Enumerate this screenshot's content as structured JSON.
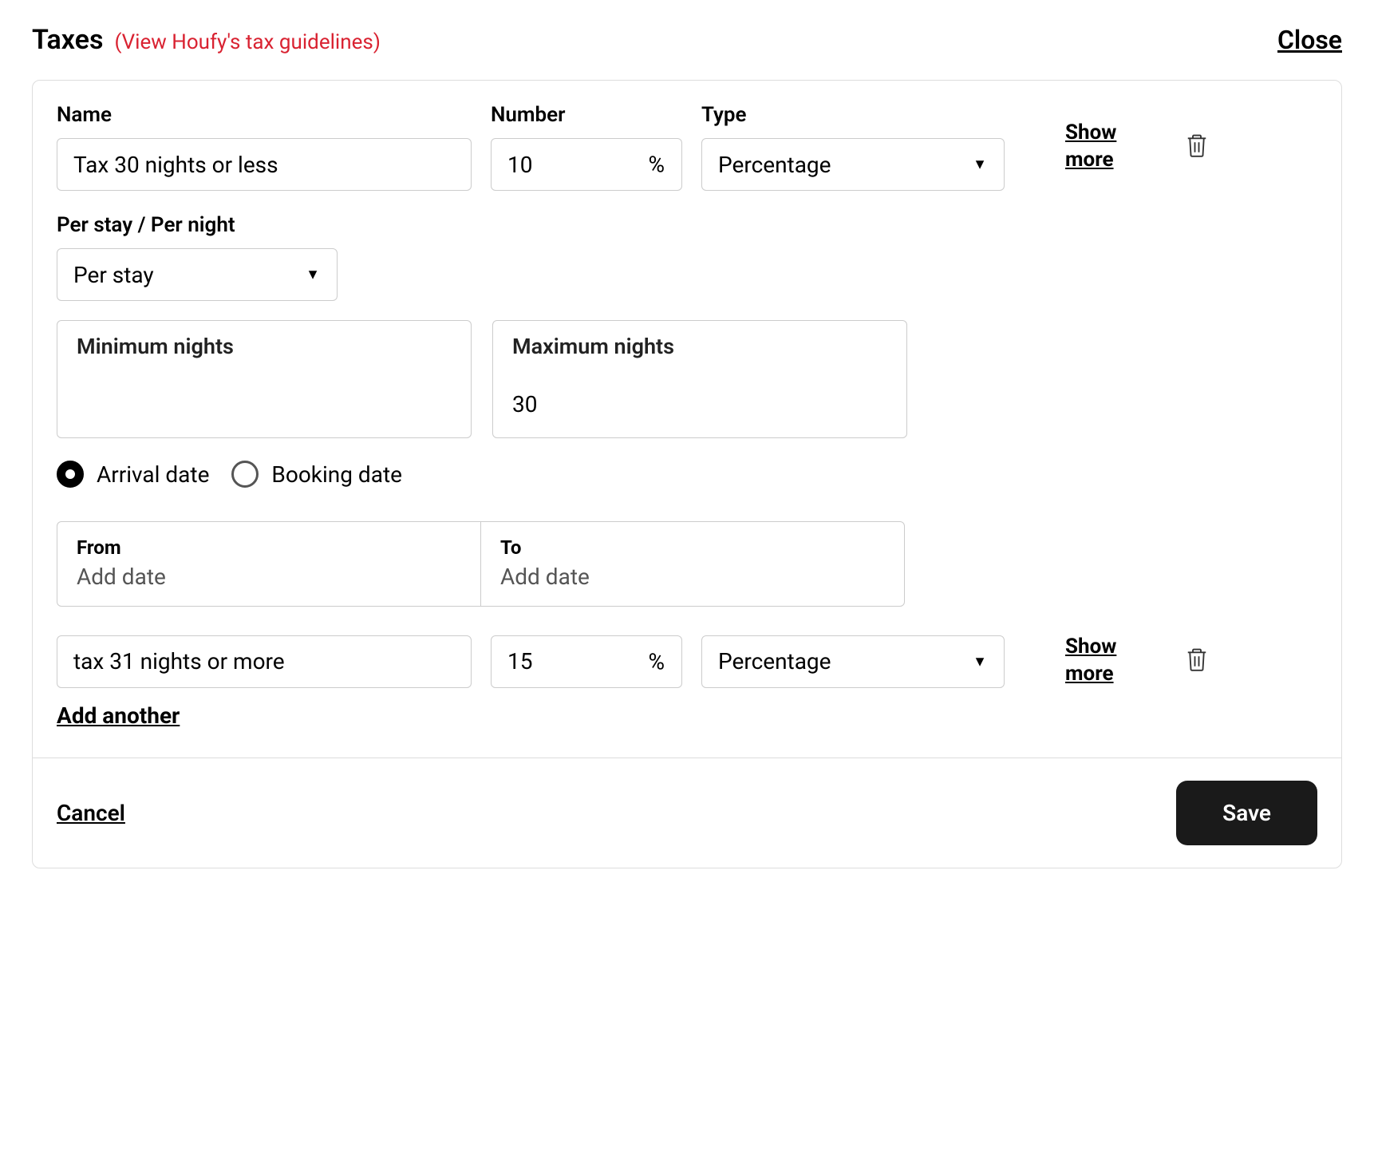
{
  "header": {
    "title": "Taxes",
    "guidelines_link": "(View Houfy's tax guidelines)",
    "close_label": "Close"
  },
  "labels": {
    "name": "Name",
    "number": "Number",
    "type": "Type",
    "per_stay_night": "Per stay / Per night",
    "min_nights": "Minimum nights",
    "max_nights": "Maximum nights",
    "from": "From",
    "to": "To",
    "add_date": "Add date",
    "show_more": "Show more",
    "add_another": "Add another",
    "cancel": "Cancel",
    "save": "Save",
    "percent_symbol": "%"
  },
  "radios": {
    "arrival": "Arrival date",
    "booking": "Booking date",
    "selected": "arrival"
  },
  "taxes": [
    {
      "name": "Tax 30 nights or less",
      "number": "10",
      "type": "Percentage",
      "per": "Per stay",
      "min_nights": "",
      "max_nights": "30",
      "from": "",
      "to": ""
    },
    {
      "name": "tax 31 nights or more",
      "number": "15",
      "type": "Percentage"
    }
  ]
}
